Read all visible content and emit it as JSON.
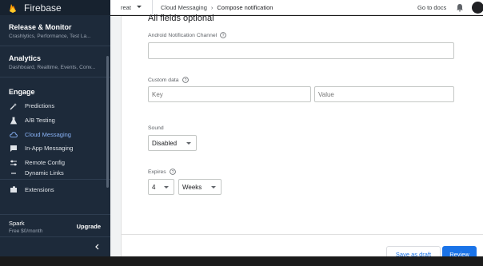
{
  "app": {
    "brand": "Firebase"
  },
  "sidebar": {
    "sections": [
      {
        "title": "Release & Monitor",
        "subtitle": "Crashlytics, Performance, Test La..."
      },
      {
        "title": "Analytics",
        "subtitle": "Dashboard, Realtime, Events, Conv..."
      }
    ],
    "engage_title": "Engage",
    "items": [
      {
        "label": "Predictions",
        "icon": "magic-wand-icon"
      },
      {
        "label": "A/B Testing",
        "icon": "flask-icon"
      },
      {
        "label": "Cloud Messaging",
        "icon": "cloud-icon",
        "active": true
      },
      {
        "label": "In-App Messaging",
        "icon": "chat-icon"
      },
      {
        "label": "Remote Config",
        "icon": "sliders-icon"
      },
      {
        "label": "Dynamic Links",
        "icon": "link-icon"
      }
    ],
    "extensions_label": "Extensions",
    "plan": {
      "name": "Spark",
      "price": "Free $0/month",
      "upgrade_label": "Upgrade"
    }
  },
  "topbar": {
    "project": "reat",
    "breadcrumb": "Cloud Messaging",
    "current": "Compose notification",
    "docs_label": "Go to docs"
  },
  "form": {
    "heading": "All fields optional",
    "android_channel_label": "Android Notification Channel",
    "android_channel_value": "",
    "custom_data_label": "Custom data",
    "key_placeholder": "Key",
    "value_placeholder": "Value",
    "sound_label": "Sound",
    "sound_value": "Disabled",
    "expires_label": "Expires",
    "expires_amount": "4",
    "expires_unit": "Weeks"
  },
  "footer": {
    "save_draft_label": "Save as draft",
    "review_label": "Review"
  },
  "colors": {
    "accent": "#1a73e8",
    "sidebar_bg": "#1d2a3a",
    "active_item": "#8ab4f8"
  }
}
